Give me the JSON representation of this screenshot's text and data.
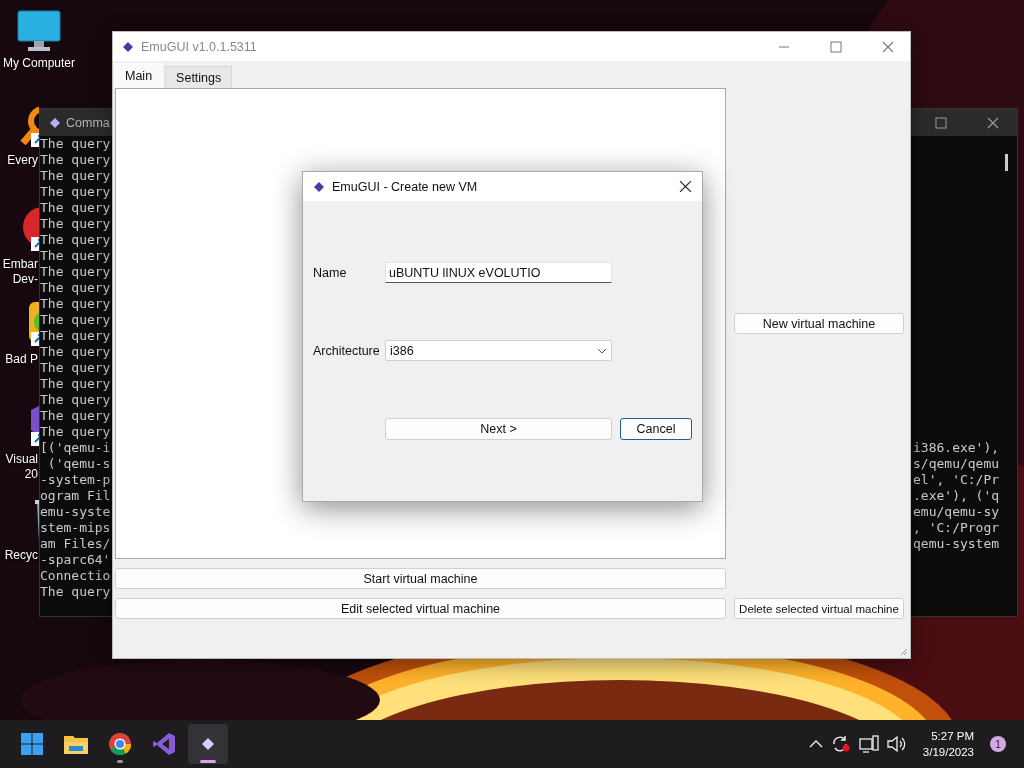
{
  "desktop_icons": [
    {
      "kind": "computer",
      "lines": [
        "My Computer"
      ],
      "cut": false
    },
    {
      "kind": "search-app",
      "lines": [
        "Every"
      ],
      "cut": true
    },
    {
      "kind": "ide",
      "lines": [
        "Embar",
        "Dev-"
      ],
      "cut": true
    },
    {
      "kind": "game",
      "lines": [
        "Bad P"
      ],
      "cut": true
    },
    {
      "kind": "studio",
      "lines": [
        "Visual",
        "20"
      ],
      "cut": true
    },
    {
      "kind": "bin",
      "lines": [
        "Recyc"
      ],
      "cut": true
    }
  ],
  "console": {
    "title": "Comma",
    "lines": [
      {
        "left": "The query"
      },
      {
        "left": "The query"
      },
      {
        "left": "The query"
      },
      {
        "left": "The query"
      },
      {
        "left": "The query"
      },
      {
        "left": "The query"
      },
      {
        "left": "The query"
      },
      {
        "left": "The query"
      },
      {
        "left": "The query"
      },
      {
        "left": "The query"
      },
      {
        "left": "The query"
      },
      {
        "left": "The query"
      },
      {
        "left": "The query"
      },
      {
        "left": "The query"
      },
      {
        "left": "The query"
      },
      {
        "left": "The query"
      },
      {
        "left": "The query"
      },
      {
        "left": "The query"
      },
      {
        "left": "The query"
      },
      {
        "left": "[('qemu-i",
        "right": "i386.exe'),"
      },
      {
        "left": " ('qemu-s",
        "right": "s/qemu/qemu"
      },
      {
        "left": "-system-p",
        "right": "el', 'C:/Pr"
      },
      {
        "left": "ogram Fil",
        "right": ".exe'), ('q"
      },
      {
        "left": "emu-syste",
        "right": "emu/qemu-sy"
      },
      {
        "left": "stem-mips",
        "right": ", 'C:/Progr"
      },
      {
        "left": "am Files/",
        "right": "qemu-system"
      },
      {
        "left": "-sparc64'"
      },
      {
        "left": "Connectio"
      },
      {
        "left": "The query"
      }
    ]
  },
  "main_window": {
    "title": "EmuGUI v1.0.1.5311",
    "tabs": [
      {
        "label": "Main",
        "selected": true
      },
      {
        "label": "Settings",
        "selected": false
      }
    ],
    "new_button": "New virtual machine",
    "start_button": "Start virtual machine",
    "edit_button": "Edit selected virtual machine",
    "delete_button": "Delete selected virtual machine"
  },
  "dialog": {
    "title": "EmuGUI - Create new VM",
    "name_field": {
      "label": "Name",
      "value": "uBUNTU lINUX eVOLUTIO"
    },
    "architecture_field": {
      "label": "Architecture",
      "value": "i386"
    },
    "buttons": [
      {
        "label": "Next >",
        "focused": false
      },
      {
        "label": "Cancel",
        "focused": true
      }
    ]
  },
  "taskbar": {
    "apps": [
      {
        "kind": "start",
        "running": false,
        "selected": false
      },
      {
        "kind": "folder",
        "running": false,
        "selected": false
      },
      {
        "kind": "browser",
        "running": true,
        "selected": false
      },
      {
        "kind": "studio",
        "running": false,
        "selected": false
      },
      {
        "kind": "emugui",
        "running": true,
        "selected": true
      }
    ],
    "time": "5:27 PM",
    "date": "3/19/2023",
    "notifications": "1"
  }
}
